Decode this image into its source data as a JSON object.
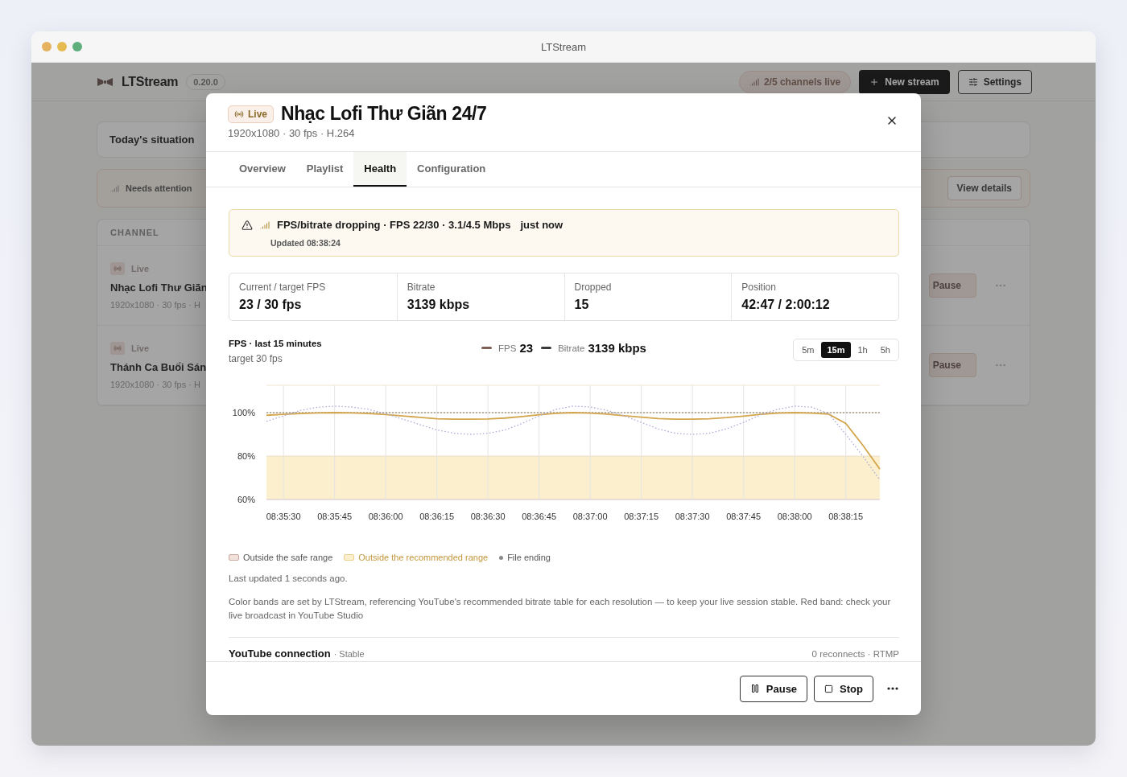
{
  "window": {
    "title": "LTStream"
  },
  "app": {
    "name": "LTStream",
    "version": "0.20.0",
    "live_count": "2/5 channels live",
    "new_button": "New stream",
    "settings_button": "Settings"
  },
  "summary": {
    "title": "Today's situation"
  },
  "attention": {
    "label": "Needs attention",
    "button": "View details"
  },
  "channels": {
    "heading": "CHANNEL",
    "rows": [
      {
        "status": "Live",
        "name": "Nhạc Lofi Thư Giãn",
        "meta": "1920x1080 · 30 fps · H",
        "action": "Pause"
      },
      {
        "status": "Live",
        "name": "Thánh Ca Buổi Sán",
        "meta": "1920x1080 · 30 fps · H",
        "action": "Pause"
      }
    ]
  },
  "modal": {
    "badge": "Live",
    "title": "Nhạc Lofi Thư Giãn 24/7",
    "subtitle": "1920x1080 · 30 fps · H.264",
    "tabs": [
      {
        "label": "Overview",
        "selected": false
      },
      {
        "label": "Playlist",
        "selected": false
      },
      {
        "label": "Health",
        "selected": true
      },
      {
        "label": "Configuration",
        "selected": false
      }
    ],
    "alert": {
      "message": "FPS/bitrate dropping · FPS 22/30 · 3.1/4.5 Mbps",
      "time": "just now",
      "updated": "Updated 08:38:24"
    },
    "stats": [
      {
        "label": "Current / target FPS",
        "value": "23 / 30 fps"
      },
      {
        "label": "Bitrate",
        "value": "3139 kbps"
      },
      {
        "label": "Dropped",
        "value": "15"
      },
      {
        "label": "Position",
        "value": "42:47 / 2:00:12"
      }
    ],
    "chart_section": {
      "title": "FPS · last 15 minutes",
      "subtitle": "target 30 fps",
      "legend": [
        {
          "value": "23",
          "color": "#7d6157"
        },
        {
          "value": "3139 kbps",
          "color": "#3a3a3a"
        }
      ],
      "ranges": [
        {
          "label": "5m",
          "selected": false
        },
        {
          "label": "15m",
          "selected": true
        },
        {
          "label": "1h",
          "selected": false
        },
        {
          "label": "5h",
          "selected": false
        }
      ],
      "chart_data": {
        "type": "line",
        "ylim": [
          60,
          112.6
        ],
        "categories": [
          null,
          "08:35:30",
          null,
          null,
          "08:35:45",
          null,
          null,
          "08:36:00",
          null,
          null,
          "08:36:15",
          null,
          null,
          "08:36:30",
          null,
          null,
          "08:36:45",
          null,
          null,
          "08:37:00",
          null,
          null,
          "08:37:15",
          null,
          null,
          "08:37:30",
          null,
          null,
          "08:37:45",
          null,
          null,
          "08:38:00",
          null,
          null,
          "08:38:15",
          null,
          null
        ],
        "yticks": [
          {
            "value": 60,
            "label": "60%"
          },
          {
            "value": 80,
            "label": "80%"
          },
          {
            "value": 100,
            "label": "100%"
          }
        ],
        "series": [
          {
            "name": "FPS",
            "color": "#d3a54c",
            "line_style": "solid",
            "values": [
              98.8,
              99.2,
              99.6,
              99.9,
              100,
              99.9,
              99.6,
              99.1,
              98.5,
              97.8,
              97.2,
              97,
              97,
              97.1,
              97.5,
              98.2,
              99,
              99.7,
              100,
              99.8,
              99.3,
              98.6,
              97.9,
              97.3,
              97,
              97,
              97.2,
              97.7,
              98.4,
              99.2,
              99.8,
              100,
              99.8,
              99.3,
              95,
              85,
              74
            ]
          },
          {
            "name": "Bitrate",
            "color": "#a9a9d6",
            "line_style": "dotted",
            "values": [
              96,
              98.5,
              101,
              102.5,
              103,
              102.6,
              101.5,
              99.5,
              97,
              94.5,
              92,
              90.5,
              90,
              90.5,
              92,
              95,
              98.5,
              101.5,
              103,
              102.6,
              101,
              98.5,
              95.5,
              92.5,
              90.5,
              90,
              90.5,
              92.5,
              95.5,
              99,
              101.5,
              103,
              102.5,
              99.5,
              90,
              80,
              69
            ]
          }
        ],
        "grid": true,
        "bands": [
          {
            "axis": "y",
            "from": 60,
            "to": 80,
            "color": "#fbefcd"
          }
        ],
        "ref_lines": [
          {
            "axis": "y",
            "value": 100
          }
        ]
      }
    },
    "range_legend": [
      {
        "kind": "swatch",
        "label": "Outside the safe range",
        "color": "#f3e1dc"
      },
      {
        "kind": "swatch",
        "label": "Outside the recommended range",
        "color": "#fbefcd"
      },
      {
        "kind": "dot",
        "label": "File ending",
        "color": "#8a8a8a"
      }
    ],
    "last_updated": "Last updated 1 seconds ago.",
    "note": "Color bands are set by LTStream, referencing YouTube's recommended bitrate table for each resolution — to keep your live session stable. Red band: check your live broadcast in YouTube Studio",
    "connection": {
      "title": "YouTube connection",
      "status": "· Stable",
      "detail": "0 reconnects · RTMP"
    },
    "actions": [
      {
        "kind": "pause",
        "label": "Pause"
      },
      {
        "kind": "stop",
        "label": "Stop"
      }
    ]
  }
}
